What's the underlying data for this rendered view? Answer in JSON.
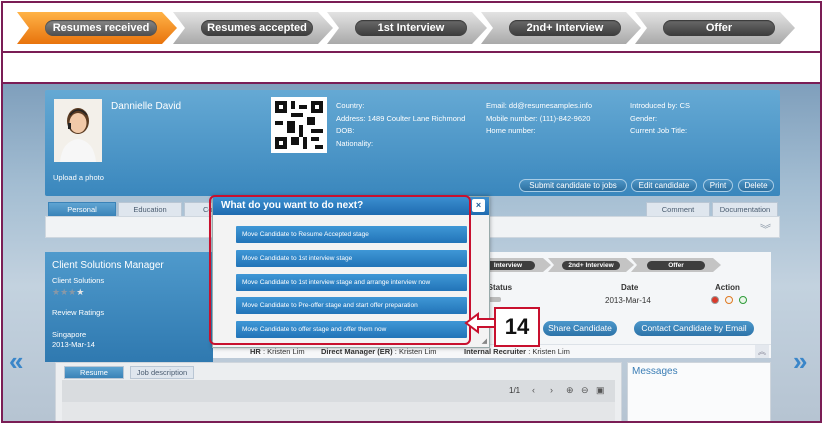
{
  "pipeline": {
    "stages": [
      {
        "label": "Resumes received"
      },
      {
        "label": "Resumes accepted"
      },
      {
        "label": "1st Interview"
      },
      {
        "label": "2nd+ Interview"
      },
      {
        "label": "Offer"
      }
    ],
    "colors": {
      "active": "#f08c1e",
      "inactive": "#c9c9c9"
    }
  },
  "profile": {
    "name": "Dannielle David",
    "upload_photo": "Upload a photo",
    "country": "Country:",
    "address": "Address: 1489 Coulter Lane Richmond",
    "dob": "DOB:",
    "nationality": "Nationality:",
    "email": "Email: dd@resumesamples.info",
    "mobile": "Mobile number: (111)-842-9620",
    "home": "Home number:",
    "introduced_by": "Introduced by: CS",
    "gender": "Gender:",
    "current_job": "Current Job Title:",
    "buttons": {
      "submit": "Submit candidate to jobs",
      "edit": "Edit candidate",
      "print": "Print",
      "delete": "Delete"
    }
  },
  "tabs": {
    "personal": "Personal",
    "education": "Education",
    "partial": "Co",
    "comment": "Comment",
    "documentation": "Documentation"
  },
  "job": {
    "title": "Client Solutions Manager",
    "department": "Client Solutions",
    "rating": 3,
    "review": "Review Ratings",
    "location": "Singapore",
    "date": "2013-Mar-14"
  },
  "job_pipeline": {
    "stages": [
      "Interview",
      "2nd+ Interview",
      "Offer"
    ],
    "status_header": "e Status",
    "date_header": "Date",
    "action_header": "Action",
    "date_value": "2013-Mar-14",
    "share_button": "Share Candidate",
    "contact_button": "Contact Candidate by Email"
  },
  "managers": {
    "hr_label": "HR",
    "hr_value": ": Kristen Lim",
    "dm_label": "Direct Manager (ER)",
    "dm_value": ": Kristen Lim",
    "ir_label": "Internal Recruiter",
    "ir_value": ": Kristen Lim"
  },
  "resume": {
    "tab_resume": "Resume",
    "tab_job": "Job description",
    "page_count": "1/1"
  },
  "messages": {
    "title": "Messages"
  },
  "modal": {
    "title": "What do you want to do next?",
    "close": "×",
    "options": [
      "Move Candidate to Resume Accepted stage",
      "Move Candidate to 1st interview stage",
      "Move Candidate to 1st interview stage and arrange interview now",
      "Move Candidate to Pre-offer stage and start offer preparation",
      "Move Candidate to offer stage and offer them now"
    ]
  },
  "callout": {
    "number": "14",
    "color": "#c8102e"
  },
  "icons": [
    "double-chevron-left-icon",
    "double-chevron-right-icon",
    "chevron-down-double-icon",
    "zoom-in-icon",
    "zoom-out-icon",
    "print-icon",
    "close-icon"
  ]
}
